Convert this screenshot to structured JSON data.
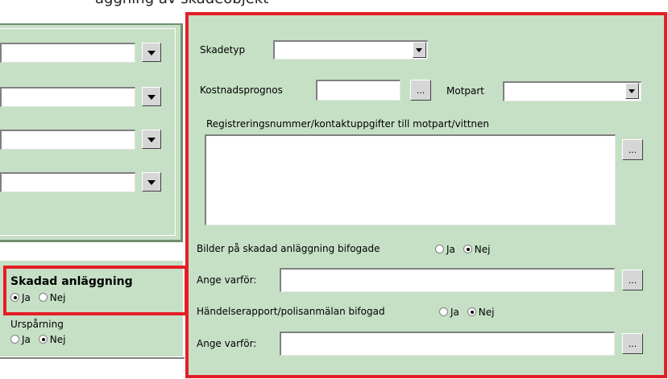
{
  "top_partial_text": "äggning av skadeobjekt",
  "left_panel": {
    "combos": [
      {
        "value": ""
      },
      {
        "value": ""
      },
      {
        "value": ""
      },
      {
        "value": ""
      }
    ]
  },
  "skadad_anlaggning": {
    "title": "Skadad anläggning",
    "ja": "Ja",
    "nej": "Nej",
    "selected": "Ja"
  },
  "urspårning": {
    "title": "Urspårning",
    "ja": "Ja",
    "nej": "Nej",
    "selected": "Nej"
  },
  "right_panel": {
    "skadetyp_label": "Skadetyp",
    "skadetyp_value": "",
    "kostnadsprognos_label": "Kostnadsprognos",
    "kostnadsprognos_value": "",
    "ellipsis": "...",
    "motpart_label": "Motpart",
    "motpart_value": "",
    "reg_label": "Registreringsnummer/kontaktuppgifter till motpart/vittnen",
    "reg_value": "",
    "bilder_label": "Bilder på skadad anläggning bifogade",
    "bilder_ja": "Ja",
    "bilder_nej": "Nej",
    "bilder_selected": "Nej",
    "ange_varfor_label": "Ange varför:",
    "ange_varfor_1_value": "",
    "handelse_label": "Händelserapport/polisanmälan bifogad",
    "handelse_ja": "Ja",
    "handelse_nej": "Nej",
    "handelse_selected": "Nej",
    "ange_varfor_2_value": ""
  },
  "colors": {
    "panel_green": "#c6e0c6",
    "highlight_red": "#e41e26"
  }
}
